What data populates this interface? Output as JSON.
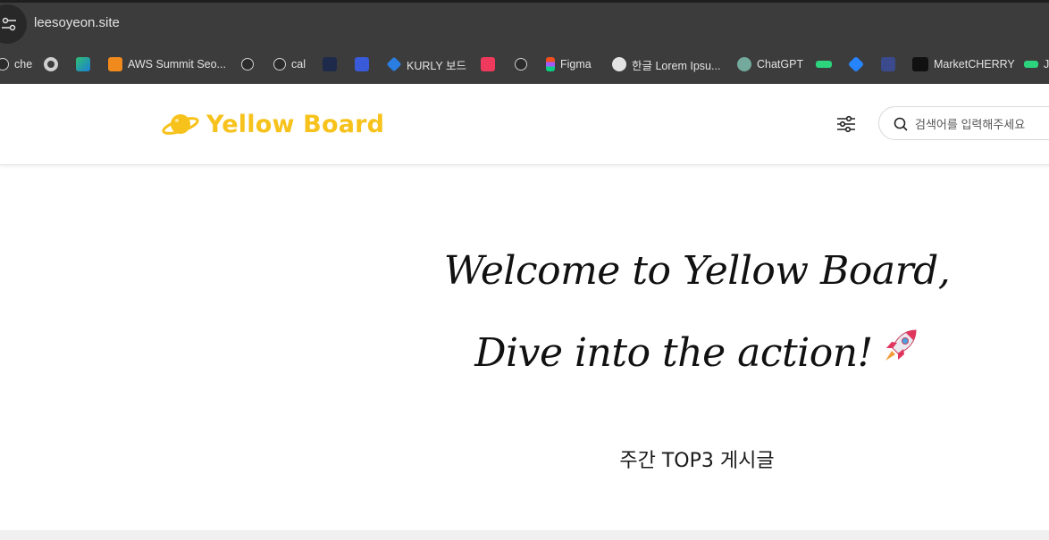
{
  "browser": {
    "url": "leesoyeon.site",
    "bookmarks": [
      {
        "label": "che",
        "icon": "notion-icon"
      },
      {
        "label": "",
        "icon": "github-icon"
      },
      {
        "label": "",
        "icon": "edge-icon"
      },
      {
        "label": "AWS Summit Seo...",
        "icon": "aws-icon"
      },
      {
        "label": "",
        "icon": "notion-icon"
      },
      {
        "label": "cal",
        "icon": "notion-icon"
      },
      {
        "label": "",
        "icon": "bird-icon"
      },
      {
        "label": "",
        "icon": "app-icon"
      },
      {
        "label": "KURLY 보드",
        "icon": "jira-icon"
      },
      {
        "label": "",
        "icon": "vivaldi-icon"
      },
      {
        "label": "",
        "icon": "notion-icon"
      },
      {
        "label": "Figma",
        "icon": "figma-icon"
      },
      {
        "label": "한글 Lorem Ipsu...",
        "icon": "wordpress-icon"
      },
      {
        "label": "ChatGPT",
        "icon": "chatgpt-icon"
      },
      {
        "label": "",
        "icon": "miro-icon"
      },
      {
        "label": "",
        "icon": "confluence-icon"
      },
      {
        "label": "",
        "icon": "chart-icon"
      },
      {
        "label": "MarketCHERRY",
        "icon": "erd-icon"
      },
      {
        "label": "Ja",
        "icon": "miro-icon"
      }
    ]
  },
  "header": {
    "logo_text": "Yellow Board",
    "search_placeholder": "검색어를 입력해주세요"
  },
  "hero": {
    "line1": "Welcome to Yellow Board,",
    "line2": "Dive into the action!"
  },
  "section": {
    "title": "주간 TOP3 게시글"
  },
  "colors": {
    "brand": "#f6c21b",
    "chrome": "#3c3c3c"
  }
}
